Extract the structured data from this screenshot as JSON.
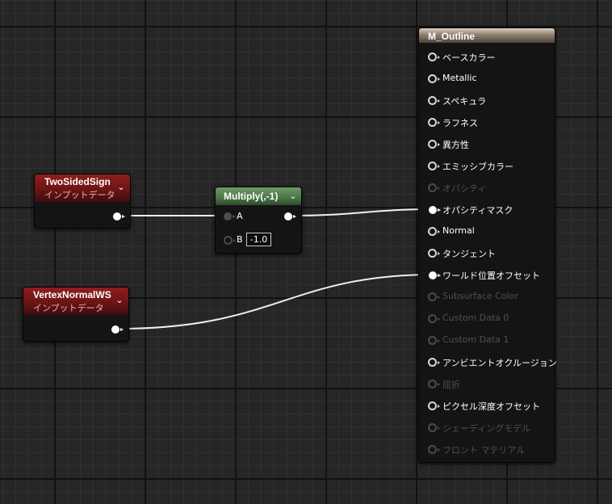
{
  "nodes": {
    "two_sided_sign": {
      "title": "TwoSidedSign",
      "subtitle": "インプットデータ"
    },
    "vertex_normal_ws": {
      "title": "VertexNormalWS",
      "subtitle": "インプットデータ"
    },
    "multiply": {
      "title": "Multiply(,-1)",
      "pin_a": "A",
      "pin_b": "B",
      "b_value": "-1.0"
    },
    "material": {
      "title": "M_Outline",
      "pins": [
        {
          "label": "ベースカラー",
          "enabled": true,
          "connected": false
        },
        {
          "label": "Metallic",
          "enabled": true,
          "connected": false
        },
        {
          "label": "スペキュラ",
          "enabled": true,
          "connected": false
        },
        {
          "label": "ラフネス",
          "enabled": true,
          "connected": false
        },
        {
          "label": "異方性",
          "enabled": true,
          "connected": false
        },
        {
          "label": "エミッシブカラー",
          "enabled": true,
          "connected": false
        },
        {
          "label": "オパシティ",
          "enabled": false,
          "connected": false
        },
        {
          "label": "オパシティマスク",
          "enabled": true,
          "connected": true
        },
        {
          "label": "Normal",
          "enabled": true,
          "connected": false
        },
        {
          "label": "タンジェント",
          "enabled": true,
          "connected": false
        },
        {
          "label": "ワールド位置オフセット",
          "enabled": true,
          "connected": true
        },
        {
          "label": "Subsurface Color",
          "enabled": false,
          "connected": false
        },
        {
          "label": "Custom Data 0",
          "enabled": false,
          "connected": false
        },
        {
          "label": "Custom Data 1",
          "enabled": false,
          "connected": false
        },
        {
          "label": "アンビエントオクルージョン",
          "enabled": true,
          "connected": false
        },
        {
          "label": "屈折",
          "enabled": false,
          "connected": false
        },
        {
          "label": "ピクセル深度オフセット",
          "enabled": true,
          "connected": false
        },
        {
          "label": "シェーディングモデル",
          "enabled": false,
          "connected": false
        },
        {
          "label": "フロント マテリアル",
          "enabled": false,
          "connected": false
        }
      ]
    }
  },
  "icons": {
    "collapse": "chevron-down-icon",
    "pin_output": "exec-pin-icon"
  },
  "colors": {
    "input_header": "#7a1a1a",
    "math_header": "#4f7a4a",
    "material_header": "#8c7e70",
    "wire": "#f0f0f0",
    "grid_bg": "#262626"
  }
}
